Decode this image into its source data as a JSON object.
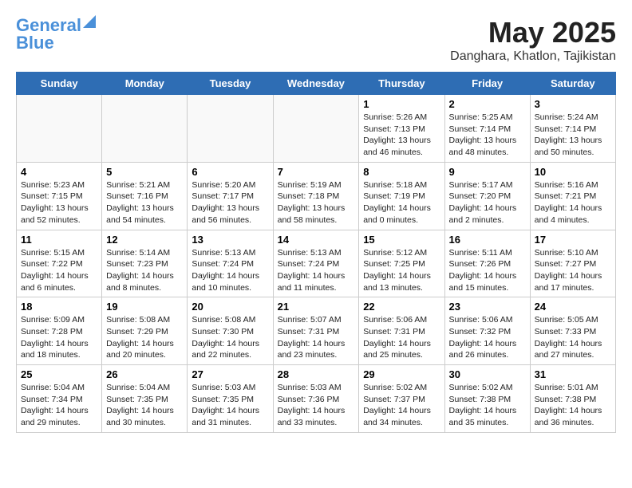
{
  "logo": {
    "line1": "General",
    "line2": "Blue"
  },
  "title": "May 2025",
  "location": "Danghara, Khatlon, Tajikistan",
  "days_of_week": [
    "Sunday",
    "Monday",
    "Tuesday",
    "Wednesday",
    "Thursday",
    "Friday",
    "Saturday"
  ],
  "weeks": [
    [
      {
        "day": "",
        "info": ""
      },
      {
        "day": "",
        "info": ""
      },
      {
        "day": "",
        "info": ""
      },
      {
        "day": "",
        "info": ""
      },
      {
        "day": "1",
        "info": "Sunrise: 5:26 AM\nSunset: 7:13 PM\nDaylight: 13 hours\nand 46 minutes."
      },
      {
        "day": "2",
        "info": "Sunrise: 5:25 AM\nSunset: 7:14 PM\nDaylight: 13 hours\nand 48 minutes."
      },
      {
        "day": "3",
        "info": "Sunrise: 5:24 AM\nSunset: 7:14 PM\nDaylight: 13 hours\nand 50 minutes."
      }
    ],
    [
      {
        "day": "4",
        "info": "Sunrise: 5:23 AM\nSunset: 7:15 PM\nDaylight: 13 hours\nand 52 minutes."
      },
      {
        "day": "5",
        "info": "Sunrise: 5:21 AM\nSunset: 7:16 PM\nDaylight: 13 hours\nand 54 minutes."
      },
      {
        "day": "6",
        "info": "Sunrise: 5:20 AM\nSunset: 7:17 PM\nDaylight: 13 hours\nand 56 minutes."
      },
      {
        "day": "7",
        "info": "Sunrise: 5:19 AM\nSunset: 7:18 PM\nDaylight: 13 hours\nand 58 minutes."
      },
      {
        "day": "8",
        "info": "Sunrise: 5:18 AM\nSunset: 7:19 PM\nDaylight: 14 hours\nand 0 minutes."
      },
      {
        "day": "9",
        "info": "Sunrise: 5:17 AM\nSunset: 7:20 PM\nDaylight: 14 hours\nand 2 minutes."
      },
      {
        "day": "10",
        "info": "Sunrise: 5:16 AM\nSunset: 7:21 PM\nDaylight: 14 hours\nand 4 minutes."
      }
    ],
    [
      {
        "day": "11",
        "info": "Sunrise: 5:15 AM\nSunset: 7:22 PM\nDaylight: 14 hours\nand 6 minutes."
      },
      {
        "day": "12",
        "info": "Sunrise: 5:14 AM\nSunset: 7:23 PM\nDaylight: 14 hours\nand 8 minutes."
      },
      {
        "day": "13",
        "info": "Sunrise: 5:13 AM\nSunset: 7:24 PM\nDaylight: 14 hours\nand 10 minutes."
      },
      {
        "day": "14",
        "info": "Sunrise: 5:13 AM\nSunset: 7:24 PM\nDaylight: 14 hours\nand 11 minutes."
      },
      {
        "day": "15",
        "info": "Sunrise: 5:12 AM\nSunset: 7:25 PM\nDaylight: 14 hours\nand 13 minutes."
      },
      {
        "day": "16",
        "info": "Sunrise: 5:11 AM\nSunset: 7:26 PM\nDaylight: 14 hours\nand 15 minutes."
      },
      {
        "day": "17",
        "info": "Sunrise: 5:10 AM\nSunset: 7:27 PM\nDaylight: 14 hours\nand 17 minutes."
      }
    ],
    [
      {
        "day": "18",
        "info": "Sunrise: 5:09 AM\nSunset: 7:28 PM\nDaylight: 14 hours\nand 18 minutes."
      },
      {
        "day": "19",
        "info": "Sunrise: 5:08 AM\nSunset: 7:29 PM\nDaylight: 14 hours\nand 20 minutes."
      },
      {
        "day": "20",
        "info": "Sunrise: 5:08 AM\nSunset: 7:30 PM\nDaylight: 14 hours\nand 22 minutes."
      },
      {
        "day": "21",
        "info": "Sunrise: 5:07 AM\nSunset: 7:31 PM\nDaylight: 14 hours\nand 23 minutes."
      },
      {
        "day": "22",
        "info": "Sunrise: 5:06 AM\nSunset: 7:31 PM\nDaylight: 14 hours\nand 25 minutes."
      },
      {
        "day": "23",
        "info": "Sunrise: 5:06 AM\nSunset: 7:32 PM\nDaylight: 14 hours\nand 26 minutes."
      },
      {
        "day": "24",
        "info": "Sunrise: 5:05 AM\nSunset: 7:33 PM\nDaylight: 14 hours\nand 27 minutes."
      }
    ],
    [
      {
        "day": "25",
        "info": "Sunrise: 5:04 AM\nSunset: 7:34 PM\nDaylight: 14 hours\nand 29 minutes."
      },
      {
        "day": "26",
        "info": "Sunrise: 5:04 AM\nSunset: 7:35 PM\nDaylight: 14 hours\nand 30 minutes."
      },
      {
        "day": "27",
        "info": "Sunrise: 5:03 AM\nSunset: 7:35 PM\nDaylight: 14 hours\nand 31 minutes."
      },
      {
        "day": "28",
        "info": "Sunrise: 5:03 AM\nSunset: 7:36 PM\nDaylight: 14 hours\nand 33 minutes."
      },
      {
        "day": "29",
        "info": "Sunrise: 5:02 AM\nSunset: 7:37 PM\nDaylight: 14 hours\nand 34 minutes."
      },
      {
        "day": "30",
        "info": "Sunrise: 5:02 AM\nSunset: 7:38 PM\nDaylight: 14 hours\nand 35 minutes."
      },
      {
        "day": "31",
        "info": "Sunrise: 5:01 AM\nSunset: 7:38 PM\nDaylight: 14 hours\nand 36 minutes."
      }
    ]
  ]
}
